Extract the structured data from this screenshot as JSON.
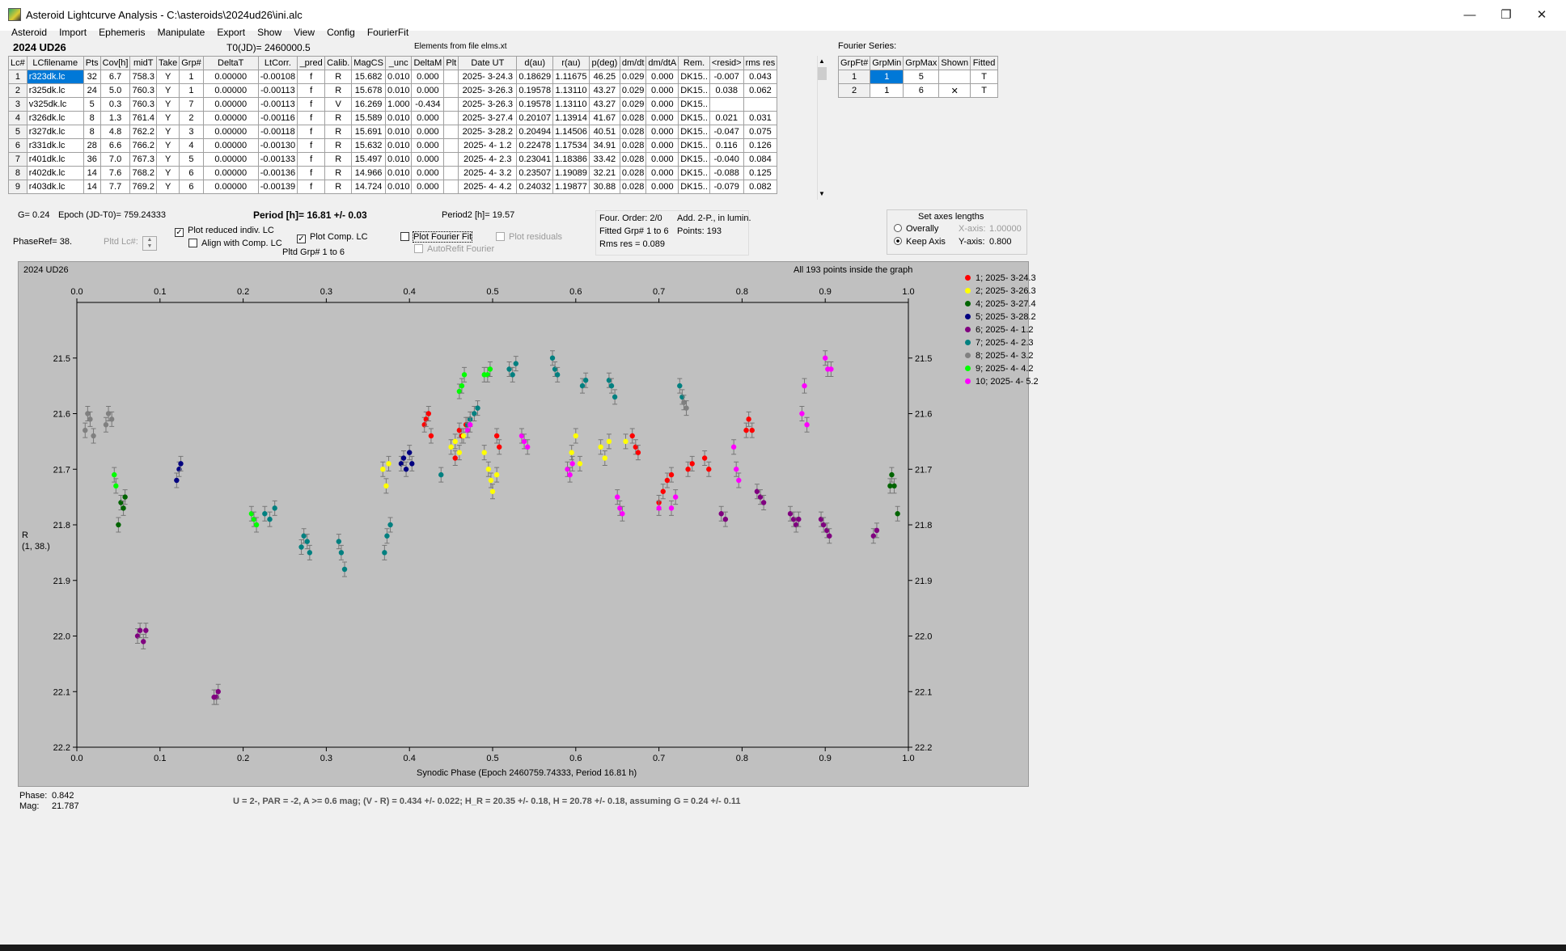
{
  "window": {
    "title": "Asteroid Lightcurve Analysis - C:\\asteroids\\2024ud26\\ini.alc",
    "minimize": "—",
    "restore": "❐",
    "close": "✕"
  },
  "menu": [
    "Asteroid",
    "Import",
    "Ephemeris",
    "Manipulate",
    "Export",
    "Show",
    "View",
    "Config",
    "FourierFit"
  ],
  "header": {
    "object": "2024 UD26",
    "t0": "T0(JD)= 2460000.5",
    "elements": "Elements from file elms.xt"
  },
  "lc_table": {
    "columns": [
      "Lc#",
      "LCfilename",
      "Pts",
      "Cov[h]",
      "midT",
      "Take",
      "Grp#",
      "DeltaT",
      "LtCorr.",
      "_pred",
      "Calib.",
      "MagCS",
      "_unc",
      "DeltaM",
      "Plt",
      "Date UT",
      "d(au)",
      "r(au)",
      "p(deg)",
      "dm/dt",
      "dm/dtA",
      "Rem.",
      "<resid>",
      "rms res"
    ],
    "rows": [
      [
        "1",
        "r323dk.lc",
        "32",
        "6.7",
        "758.3",
        "Y",
        "1",
        "0.00000",
        "-0.00108",
        "f",
        "R",
        "15.682",
        "0.010",
        "0.000",
        "",
        "2025- 3-24.3",
        "0.18629",
        "1.11675",
        "46.25",
        "0.029",
        "0.000",
        "DK15..",
        "-0.007",
        "0.043"
      ],
      [
        "2",
        "r325dk.lc",
        "24",
        "5.0",
        "760.3",
        "Y",
        "1",
        "0.00000",
        "-0.00113",
        "f",
        "R",
        "15.678",
        "0.010",
        "0.000",
        "",
        "2025- 3-26.3",
        "0.19578",
        "1.13110",
        "43.27",
        "0.029",
        "0.000",
        "DK15..",
        "0.038",
        "0.062"
      ],
      [
        "3",
        "v325dk.lc",
        "5",
        "0.3",
        "760.3",
        "Y",
        "7",
        "0.00000",
        "-0.00113",
        "f",
        "V",
        "16.269",
        "1.000",
        "-0.434",
        "",
        "2025- 3-26.3",
        "0.19578",
        "1.13110",
        "43.27",
        "0.029",
        "0.000",
        "DK15..",
        "",
        ""
      ],
      [
        "4",
        "r326dk.lc",
        "8",
        "1.3",
        "761.4",
        "Y",
        "2",
        "0.00000",
        "-0.00116",
        "f",
        "R",
        "15.589",
        "0.010",
        "0.000",
        "",
        "2025- 3-27.4",
        "0.20107",
        "1.13914",
        "41.67",
        "0.028",
        "0.000",
        "DK15..",
        "0.021",
        "0.031"
      ],
      [
        "5",
        "r327dk.lc",
        "8",
        "4.8",
        "762.2",
        "Y",
        "3",
        "0.00000",
        "-0.00118",
        "f",
        "R",
        "15.691",
        "0.010",
        "0.000",
        "",
        "2025- 3-28.2",
        "0.20494",
        "1.14506",
        "40.51",
        "0.028",
        "0.000",
        "DK15..",
        "-0.047",
        "0.075"
      ],
      [
        "6",
        "r331dk.lc",
        "28",
        "6.6",
        "766.2",
        "Y",
        "4",
        "0.00000",
        "-0.00130",
        "f",
        "R",
        "15.632",
        "0.010",
        "0.000",
        "",
        "2025- 4- 1.2",
        "0.22478",
        "1.17534",
        "34.91",
        "0.028",
        "0.000",
        "DK15..",
        "0.116",
        "0.126"
      ],
      [
        "7",
        "r401dk.lc",
        "36",
        "7.0",
        "767.3",
        "Y",
        "5",
        "0.00000",
        "-0.00133",
        "f",
        "R",
        "15.497",
        "0.010",
        "0.000",
        "",
        "2025- 4- 2.3",
        "0.23041",
        "1.18386",
        "33.42",
        "0.028",
        "0.000",
        "DK15..",
        "-0.040",
        "0.084"
      ],
      [
        "8",
        "r402dk.lc",
        "14",
        "7.6",
        "768.2",
        "Y",
        "6",
        "0.00000",
        "-0.00136",
        "f",
        "R",
        "14.966",
        "0.010",
        "0.000",
        "",
        "2025- 4- 3.2",
        "0.23507",
        "1.19089",
        "32.21",
        "0.028",
        "0.000",
        "DK15..",
        "-0.088",
        "0.125"
      ],
      [
        "9",
        "r403dk.lc",
        "14",
        "7.7",
        "769.2",
        "Y",
        "6",
        "0.00000",
        "-0.00139",
        "f",
        "R",
        "14.724",
        "0.010",
        "0.000",
        "",
        "2025- 4- 4.2",
        "0.24032",
        "1.19877",
        "30.88",
        "0.028",
        "0.000",
        "DK15..",
        "-0.079",
        "0.082"
      ]
    ]
  },
  "fourier_table": {
    "title": "Fourier Series:",
    "columns": [
      "GrpFt#",
      "GrpMin",
      "GrpMax",
      "Shown",
      "Fitted"
    ],
    "rows": [
      [
        "1",
        "1",
        "5",
        "",
        "T"
      ],
      [
        "2",
        "1",
        "6",
        "✕",
        "T"
      ]
    ]
  },
  "info": {
    "g": "G= 0.24",
    "epoch": "Epoch (JD-T0)= 759.24333",
    "period": "Period [h]= 16.81 +/- 0.03",
    "period2": "Period2 [h]= 19.57",
    "phaseref": "PhaseRef= 38.",
    "pltd_lc": "Pltd Lc#:",
    "plot_reduced": "Plot reduced indiv. LC",
    "align_comp": "Align with Comp. LC",
    "plot_comp": "Plot Comp. LC",
    "pltd_grp": "Pltd Grp#  1   to   6",
    "plot_fourier": "Plot Fourier Fit",
    "autorefit": "AutoRefit Fourier",
    "plot_residuals": "Plot residuals",
    "four_order": "Four. Order:  2/0",
    "add_2p": "Add. 2-P., in lumin.",
    "fitted_grp": "Fitted Grp# 1 to 6",
    "points": "Points: 193",
    "rms_res": "Rms res      = 0.089"
  },
  "axes_box": {
    "title": "Set axes lengths",
    "overall": "Overally",
    "keep": "Keep Axis",
    "xaxis_label": "X-axis:",
    "xaxis_value": "1.00000",
    "yaxis_label": "Y-axis:",
    "yaxis_value": "0.800"
  },
  "graph": {
    "title": "2024 UD26",
    "status": "All 193 points inside the graph",
    "xlabel": "Synodic Phase (Epoch 2460759.74333, Period 16.81 h)",
    "ylabel": "R",
    "ylabel2": "(1, 38.)",
    "xticks": [
      "0.0",
      "0.1",
      "0.2",
      "0.3",
      "0.4",
      "0.5",
      "0.6",
      "0.7",
      "0.8",
      "0.9",
      "1.0"
    ],
    "yticks": [
      "21.5",
      "21.6",
      "21.7",
      "21.8",
      "21.9",
      "22.0",
      "22.1",
      "22.2"
    ]
  },
  "chart_data": {
    "type": "scatter",
    "title": "2024 UD26",
    "xlabel": "Synodic Phase (Epoch 2460759.74333, Period 16.81 h)",
    "ylabel": "R",
    "xlim": [
      0.0,
      1.0
    ],
    "ylim": [
      22.2,
      21.4
    ],
    "series": [
      {
        "name": "1; 2025- 3-24.3",
        "color": "#ff0000",
        "points": [
          [
            0.418,
            21.62
          ],
          [
            0.42,
            21.61
          ],
          [
            0.423,
            21.6
          ],
          [
            0.426,
            21.64
          ],
          [
            0.46,
            21.63
          ],
          [
            0.463,
            21.64
          ],
          [
            0.468,
            21.62
          ],
          [
            0.455,
            21.68
          ],
          [
            0.505,
            21.64
          ],
          [
            0.508,
            21.66
          ],
          [
            0.668,
            21.64
          ],
          [
            0.672,
            21.66
          ],
          [
            0.675,
            21.67
          ],
          [
            0.7,
            21.76
          ],
          [
            0.705,
            21.74
          ],
          [
            0.71,
            21.72
          ],
          [
            0.715,
            21.71
          ],
          [
            0.735,
            21.7
          ],
          [
            0.74,
            21.69
          ],
          [
            0.755,
            21.68
          ],
          [
            0.76,
            21.7
          ],
          [
            0.805,
            21.63
          ],
          [
            0.808,
            21.61
          ],
          [
            0.812,
            21.63
          ]
        ]
      },
      {
        "name": "2; 2025- 3-26.3",
        "color": "#ffff00",
        "points": [
          [
            0.368,
            21.7
          ],
          [
            0.372,
            21.73
          ],
          [
            0.375,
            21.69
          ],
          [
            0.45,
            21.66
          ],
          [
            0.455,
            21.65
          ],
          [
            0.46,
            21.67
          ],
          [
            0.465,
            21.64
          ],
          [
            0.49,
            21.67
          ],
          [
            0.495,
            21.7
          ],
          [
            0.498,
            21.72
          ],
          [
            0.5,
            21.74
          ],
          [
            0.505,
            21.71
          ],
          [
            0.595,
            21.67
          ],
          [
            0.6,
            21.64
          ],
          [
            0.605,
            21.69
          ],
          [
            0.63,
            21.66
          ],
          [
            0.635,
            21.68
          ],
          [
            0.64,
            21.65
          ],
          [
            0.66,
            21.65
          ]
        ]
      },
      {
        "name": "4; 2025- 3-27.4",
        "color": "#006400",
        "points": [
          [
            0.05,
            21.8
          ],
          [
            0.053,
            21.76
          ],
          [
            0.056,
            21.77
          ],
          [
            0.058,
            21.75
          ],
          [
            0.978,
            21.73
          ],
          [
            0.98,
            21.71
          ],
          [
            0.983,
            21.73
          ],
          [
            0.987,
            21.78
          ]
        ]
      },
      {
        "name": "5; 2025- 3-28.2",
        "color": "#000080",
        "points": [
          [
            0.12,
            21.72
          ],
          [
            0.123,
            21.7
          ],
          [
            0.125,
            21.69
          ],
          [
            0.39,
            21.69
          ],
          [
            0.393,
            21.68
          ],
          [
            0.396,
            21.7
          ],
          [
            0.4,
            21.67
          ],
          [
            0.403,
            21.69
          ]
        ]
      },
      {
        "name": "6; 2025- 4- 1.2",
        "color": "#800080",
        "points": [
          [
            0.073,
            22.0
          ],
          [
            0.076,
            21.99
          ],
          [
            0.08,
            22.01
          ],
          [
            0.083,
            21.99
          ],
          [
            0.165,
            22.11
          ],
          [
            0.168,
            22.11
          ],
          [
            0.17,
            22.1
          ],
          [
            0.775,
            21.78
          ],
          [
            0.78,
            21.79
          ],
          [
            0.818,
            21.74
          ],
          [
            0.822,
            21.75
          ],
          [
            0.826,
            21.76
          ],
          [
            0.858,
            21.78
          ],
          [
            0.862,
            21.79
          ],
          [
            0.865,
            21.8
          ],
          [
            0.868,
            21.79
          ],
          [
            0.895,
            21.79
          ],
          [
            0.898,
            21.8
          ],
          [
            0.902,
            21.81
          ],
          [
            0.905,
            21.82
          ],
          [
            0.958,
            21.82
          ],
          [
            0.962,
            21.81
          ]
        ]
      },
      {
        "name": "7; 2025- 4- 2.3",
        "color": "#008080",
        "points": [
          [
            0.226,
            21.78
          ],
          [
            0.232,
            21.79
          ],
          [
            0.238,
            21.77
          ],
          [
            0.27,
            21.84
          ],
          [
            0.273,
            21.82
          ],
          [
            0.277,
            21.83
          ],
          [
            0.28,
            21.85
          ],
          [
            0.315,
            21.83
          ],
          [
            0.318,
            21.85
          ],
          [
            0.322,
            21.88
          ],
          [
            0.37,
            21.85
          ],
          [
            0.373,
            21.82
          ],
          [
            0.377,
            21.8
          ],
          [
            0.438,
            21.71
          ],
          [
            0.47,
            21.62
          ],
          [
            0.473,
            21.61
          ],
          [
            0.478,
            21.6
          ],
          [
            0.482,
            21.59
          ],
          [
            0.52,
            21.52
          ],
          [
            0.524,
            21.53
          ],
          [
            0.528,
            21.51
          ],
          [
            0.572,
            21.5
          ],
          [
            0.575,
            21.52
          ],
          [
            0.578,
            21.53
          ],
          [
            0.608,
            21.55
          ],
          [
            0.612,
            21.54
          ],
          [
            0.64,
            21.54
          ],
          [
            0.643,
            21.55
          ],
          [
            0.647,
            21.57
          ],
          [
            0.725,
            21.55
          ],
          [
            0.728,
            21.57
          ]
        ]
      },
      {
        "name": "8; 2025- 4- 3.2",
        "color": "#808080",
        "points": [
          [
            0.01,
            21.63
          ],
          [
            0.013,
            21.6
          ],
          [
            0.016,
            21.61
          ],
          [
            0.02,
            21.64
          ],
          [
            0.035,
            21.62
          ],
          [
            0.038,
            21.6
          ],
          [
            0.042,
            21.61
          ],
          [
            0.73,
            21.58
          ],
          [
            0.733,
            21.59
          ]
        ]
      },
      {
        "name": "9; 2025- 4- 4.2",
        "color": "#00ff00",
        "points": [
          [
            0.045,
            21.71
          ],
          [
            0.047,
            21.73
          ],
          [
            0.21,
            21.78
          ],
          [
            0.213,
            21.79
          ],
          [
            0.216,
            21.8
          ],
          [
            0.46,
            21.56
          ],
          [
            0.463,
            21.55
          ],
          [
            0.466,
            21.53
          ],
          [
            0.49,
            21.53
          ],
          [
            0.494,
            21.53
          ],
          [
            0.497,
            21.52
          ]
        ]
      },
      {
        "name": "10; 2025- 4- 5.2",
        "color": "#ff00ff",
        "points": [
          [
            0.47,
            21.63
          ],
          [
            0.473,
            21.62
          ],
          [
            0.535,
            21.64
          ],
          [
            0.538,
            21.65
          ],
          [
            0.542,
            21.66
          ],
          [
            0.59,
            21.7
          ],
          [
            0.593,
            21.71
          ],
          [
            0.596,
            21.69
          ],
          [
            0.65,
            21.75
          ],
          [
            0.653,
            21.77
          ],
          [
            0.656,
            21.78
          ],
          [
            0.7,
            21.77
          ],
          [
            0.715,
            21.77
          ],
          [
            0.72,
            21.75
          ],
          [
            0.79,
            21.66
          ],
          [
            0.793,
            21.7
          ],
          [
            0.796,
            21.72
          ],
          [
            0.872,
            21.6
          ],
          [
            0.875,
            21.55
          ],
          [
            0.878,
            21.62
          ],
          [
            0.9,
            21.5
          ],
          [
            0.903,
            21.52
          ],
          [
            0.907,
            21.52
          ]
        ]
      }
    ]
  },
  "status": {
    "phase_label": "Phase:",
    "phase_value": "0.842",
    "mag_label": "Mag:",
    "mag_value": "21.787",
    "summary": "U = 2-, PAR = -2, A >= 0.6 mag; (V - R) = 0.434 +/- 0.022; H_R = 20.35 +/- 0.18, H = 20.78 +/- 0.18, assuming G = 0.24 +/- 0.11"
  }
}
